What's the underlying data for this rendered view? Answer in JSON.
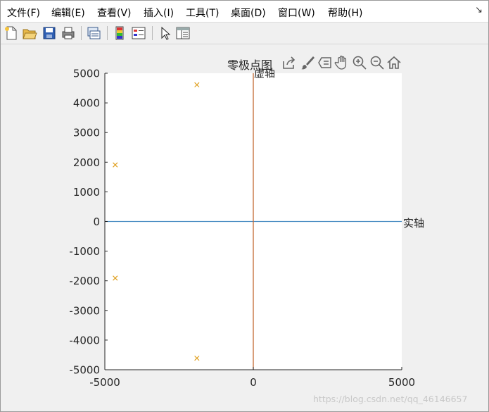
{
  "menu": [
    "文件(F)",
    "编辑(E)",
    "查看(V)",
    "插入(I)",
    "工具(T)",
    "桌面(D)",
    "窗口(W)",
    "帮助(H)"
  ],
  "menu_end_icon": "dock-arrow-icon",
  "toolbar": {
    "icons": [
      "new-figure-icon",
      "open-file-icon",
      "save-icon",
      "print-icon",
      "link-figure-icon",
      "colorbar-icon",
      "legend-icon",
      "edit-plot-arrow-icon",
      "property-inspector-icon"
    ]
  },
  "axes_toolbar": {
    "title": "零极点图",
    "icons": [
      "export-icon",
      "brush-icon",
      "datatip-icon",
      "pan-hand-icon",
      "zoom-in-icon",
      "zoom-out-icon",
      "home-icon"
    ]
  },
  "colors": {
    "real_axis": "#4e8fc4",
    "imag_axis": "#c46a33",
    "pole": "#e0a020"
  },
  "chart_data": {
    "type": "scatter",
    "title": "",
    "xlabel": "实轴",
    "ylabel": "虚轴",
    "xlim": [
      -5000,
      5000
    ],
    "ylim": [
      -5000,
      5000
    ],
    "xticks": [
      -5000,
      0,
      5000
    ],
    "yticks": [
      5000,
      4000,
      3000,
      2000,
      1000,
      0,
      -1000,
      -2000,
      -3000,
      -4000,
      -5000
    ],
    "grid": false,
    "series": [
      {
        "marker": "x",
        "points": [
          {
            "x": -1900,
            "y": 4610
          },
          {
            "x": -4650,
            "y": 1910
          },
          {
            "x": -4650,
            "y": -1910
          },
          {
            "x": -1900,
            "y": -4610
          }
        ]
      }
    ]
  },
  "watermark": "https://blog.csdn.net/qq_46146657"
}
